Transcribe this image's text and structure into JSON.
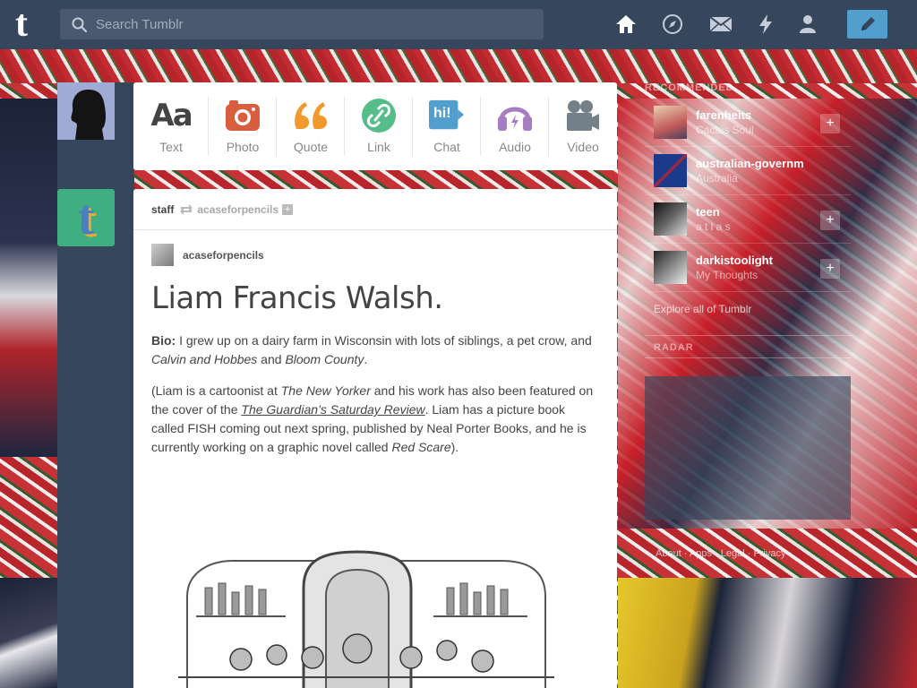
{
  "topbar": {
    "logo": "t",
    "search_placeholder": "Search Tumblr",
    "nav_icons": [
      "home-icon",
      "explore-icon",
      "mail-icon",
      "activity-icon",
      "account-icon"
    ],
    "compose_icon": "pencil-icon"
  },
  "post_types": [
    {
      "label": "Text",
      "icon": "Aa",
      "color": "#444444"
    },
    {
      "label": "Photo",
      "icon": "camera-icon",
      "color": "#d95e40"
    },
    {
      "label": "Quote",
      "icon": "quote-icon",
      "color": "#f2992e"
    },
    {
      "label": "Link",
      "icon": "link-icon",
      "color": "#56bc8a"
    },
    {
      "label": "Chat",
      "icon": "chat-icon",
      "color": "#529ecc",
      "text": "hi!"
    },
    {
      "label": "Audio",
      "icon": "headphones-icon",
      "color": "#a77dc2"
    },
    {
      "label": "Video",
      "icon": "video-camera-icon",
      "color": "#748089"
    }
  ],
  "post": {
    "header_user": "staff",
    "header_reblogged": "acaseforpencils",
    "source_name": "acaseforpencils",
    "title": "Liam Francis Walsh.",
    "bio_label": "Bio:",
    "bio_text_1": " I grew up on a dairy farm in Wisconsin with lots of siblings, a pet crow, and ",
    "bio_italic_1": "Calvin and Hobbes",
    "bio_text_2": " and ",
    "bio_italic_2": "Bloom County",
    "bio_text_3": ".",
    "p2_1": "(Liam is a cartoonist at ",
    "p2_i1": "The New Yorker",
    "p2_2": " and his work has also been featured on the cover of the ",
    "p2_link": "The Guardian’s Saturday Review",
    "p2_3": ". Liam has a picture book called FISH coming out next spring, published by Neal Porter Books, and he is currently working on a graphic novel called ",
    "p2_i2": "Red Scare",
    "p2_4": ")."
  },
  "sidebar": {
    "heading": "RECOMMENDED",
    "blogs": [
      {
        "name": "farenheits",
        "sub": "Cactus Soul"
      },
      {
        "name": "australian-governm",
        "sub": "Australia"
      },
      {
        "name": "teen",
        "sub": "a t l a s"
      },
      {
        "name": "darkistoolight",
        "sub": "My Thoughts"
      }
    ],
    "explore": "Explore all of Tumblr",
    "radar": "RADAR",
    "footer": "About · Apps · Legal · Privacy"
  }
}
